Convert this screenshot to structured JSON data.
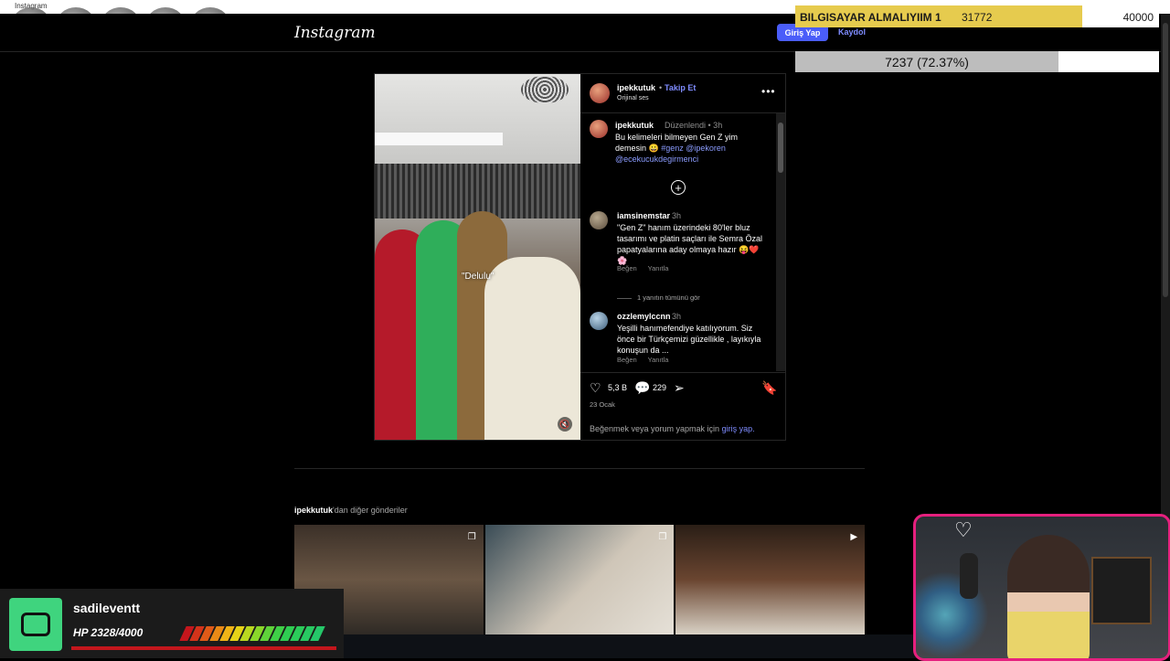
{
  "window": {
    "title": "Instagram"
  },
  "header": {
    "logo": "Instagram",
    "login_label": "Giriş Yap",
    "signup_label": "Kaydol"
  },
  "donation": {
    "name": "BILGISAYAR ALMALIYIIM 1",
    "current": "31772",
    "goal": "40000",
    "progress": 0.79
  },
  "progress_bar": {
    "text": "7237 (72.37%)",
    "progress": 0.7237
  },
  "post": {
    "username": "ipekkutuk",
    "separator": "•",
    "follow_label": "Takip Et",
    "audio": "Orijinal ses",
    "media_overlay_text": "\"Delulu\"",
    "caption": {
      "username": "ipekkutuk",
      "meta": "Düzenlendi • 3h",
      "text": "Bu kelimeleri bilmeyen Gen Z yim demesin 😀",
      "tags": "#genz @ipekoren @ecekucukdegirmenci"
    },
    "comments": [
      {
        "username": "iamsinemstar",
        "time": "3h",
        "text": "\"Gen Z\" hanım üzerindeki 80'ler bluz tasarımı ve platin saçları ile Semra Özal papatyalarına aday olmaya hazır 😝❤️🌸",
        "like": "Beğen",
        "reply": "Yanıtla"
      },
      {
        "username": "ozzlemylccnn",
        "time": "3h",
        "text": "Yeşilli hanımefendiye katılıyorum. Siz önce bir Türkçemizi güzellikle , layıkıyla konuşun da ...",
        "like": "Beğen",
        "reply": "Yanıtla"
      }
    ],
    "see_replies": "1 yanıtın tümünü gör",
    "likes": "5,3 B",
    "comments_count": "229",
    "date": "23 Ocak",
    "login_prompt": "Beğenmek veya yorum yapmak için",
    "login_link": "giriş yap."
  },
  "more_posts": {
    "username": "ipekkutuk",
    "suffix": "'dan diğer gönderiler"
  },
  "hp_widget": {
    "name": "sadileventt",
    "hp_text": "HP 2328/4000",
    "hp_fraction": 0.582
  },
  "colors": {
    "accent": "#4a5df9",
    "link": "#7f8cff",
    "donation": "#e6cb4e",
    "webcam_border": "#e6207e",
    "hp_green": "#3fd47e"
  }
}
